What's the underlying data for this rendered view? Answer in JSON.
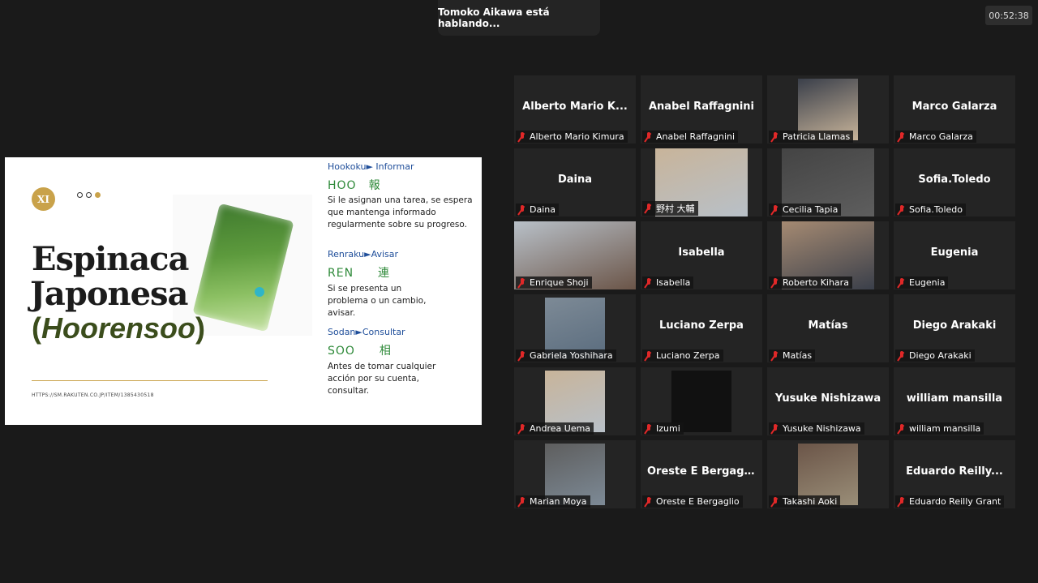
{
  "banner": {
    "speaking": "Tomoko Aikawa está hablando..."
  },
  "timer": "00:52:38",
  "slide": {
    "badge": "XI",
    "title_line1": "Espinaca",
    "title_line2": "Japonesa",
    "title_open": "(",
    "title_word": "Hoorensoo",
    "title_close": ")",
    "source": "HTTPS://SM.RAKUTEN.CO.JP/ITEM/1385430518",
    "sections": [
      {
        "header": "Hookoku► Informar",
        "kanji": "HOO　報",
        "text": "Si le asignan una tarea, se espera que mantenga informado regularmente sobre su progreso."
      },
      {
        "header": "Renraku►Avisar",
        "kanji": "REN　　連",
        "text": "Si se presenta un problema o un cambio, avisar."
      },
      {
        "header": "Sodan►Consultar",
        "kanji": "SOO　　相",
        "text": "Antes de tomar cualquier acción por su cuenta, consultar."
      }
    ]
  },
  "participants": [
    {
      "big": "Alberto  Mario  K...",
      "label": "Alberto Mario Kimura",
      "video": ""
    },
    {
      "big": "Anabel Raffagnini",
      "label": "Anabel Raffagnini",
      "video": ""
    },
    {
      "big": "",
      "label": "Patricia Llamas",
      "video": "portrait"
    },
    {
      "big": "Marco Galarza",
      "label": "Marco Galarza",
      "video": ""
    },
    {
      "big": "Daina",
      "label": "Daina",
      "video": ""
    },
    {
      "big": "",
      "label": "野村 大輔",
      "video": "mid"
    },
    {
      "big": "",
      "label": "Cecilia Tapia",
      "video": "mid"
    },
    {
      "big": "Sofia.Toledo",
      "label": "Sofia.Toledo",
      "video": ""
    },
    {
      "big": "",
      "label": "Enrique Shoji",
      "video": "wide"
    },
    {
      "big": "Isabella",
      "label": "Isabella",
      "video": ""
    },
    {
      "big": "",
      "label": "Roberto Kihara",
      "video": "mid"
    },
    {
      "big": "Eugenia",
      "label": "Eugenia",
      "video": ""
    },
    {
      "big": "",
      "label": "Gabriela Yoshihara",
      "video": "portrait"
    },
    {
      "big": "Luciano Zerpa",
      "label": "Luciano Zerpa",
      "video": ""
    },
    {
      "big": "Matías",
      "label": "Matías",
      "video": ""
    },
    {
      "big": "Diego Arakaki",
      "label": "Diego Arakaki",
      "video": ""
    },
    {
      "big": "",
      "label": "Andrea Uema",
      "video": "portrait"
    },
    {
      "big": "",
      "label": "Izumi",
      "video": "portrait"
    },
    {
      "big": "Yusuke Nishizawa",
      "label": "Yusuke Nishizawa",
      "video": ""
    },
    {
      "big": "william mansilla",
      "label": "william mansilla",
      "video": ""
    },
    {
      "big": "",
      "label": "Marian Moya",
      "video": "portrait"
    },
    {
      "big": "Oreste  E  Bergag...",
      "label": "Oreste E Bergaglio",
      "video": ""
    },
    {
      "big": "",
      "label": "Takashi Aoki",
      "video": "portrait"
    },
    {
      "big": "Eduardo  Reilly...",
      "label": "Eduardo Reilly Grant",
      "video": ""
    }
  ]
}
